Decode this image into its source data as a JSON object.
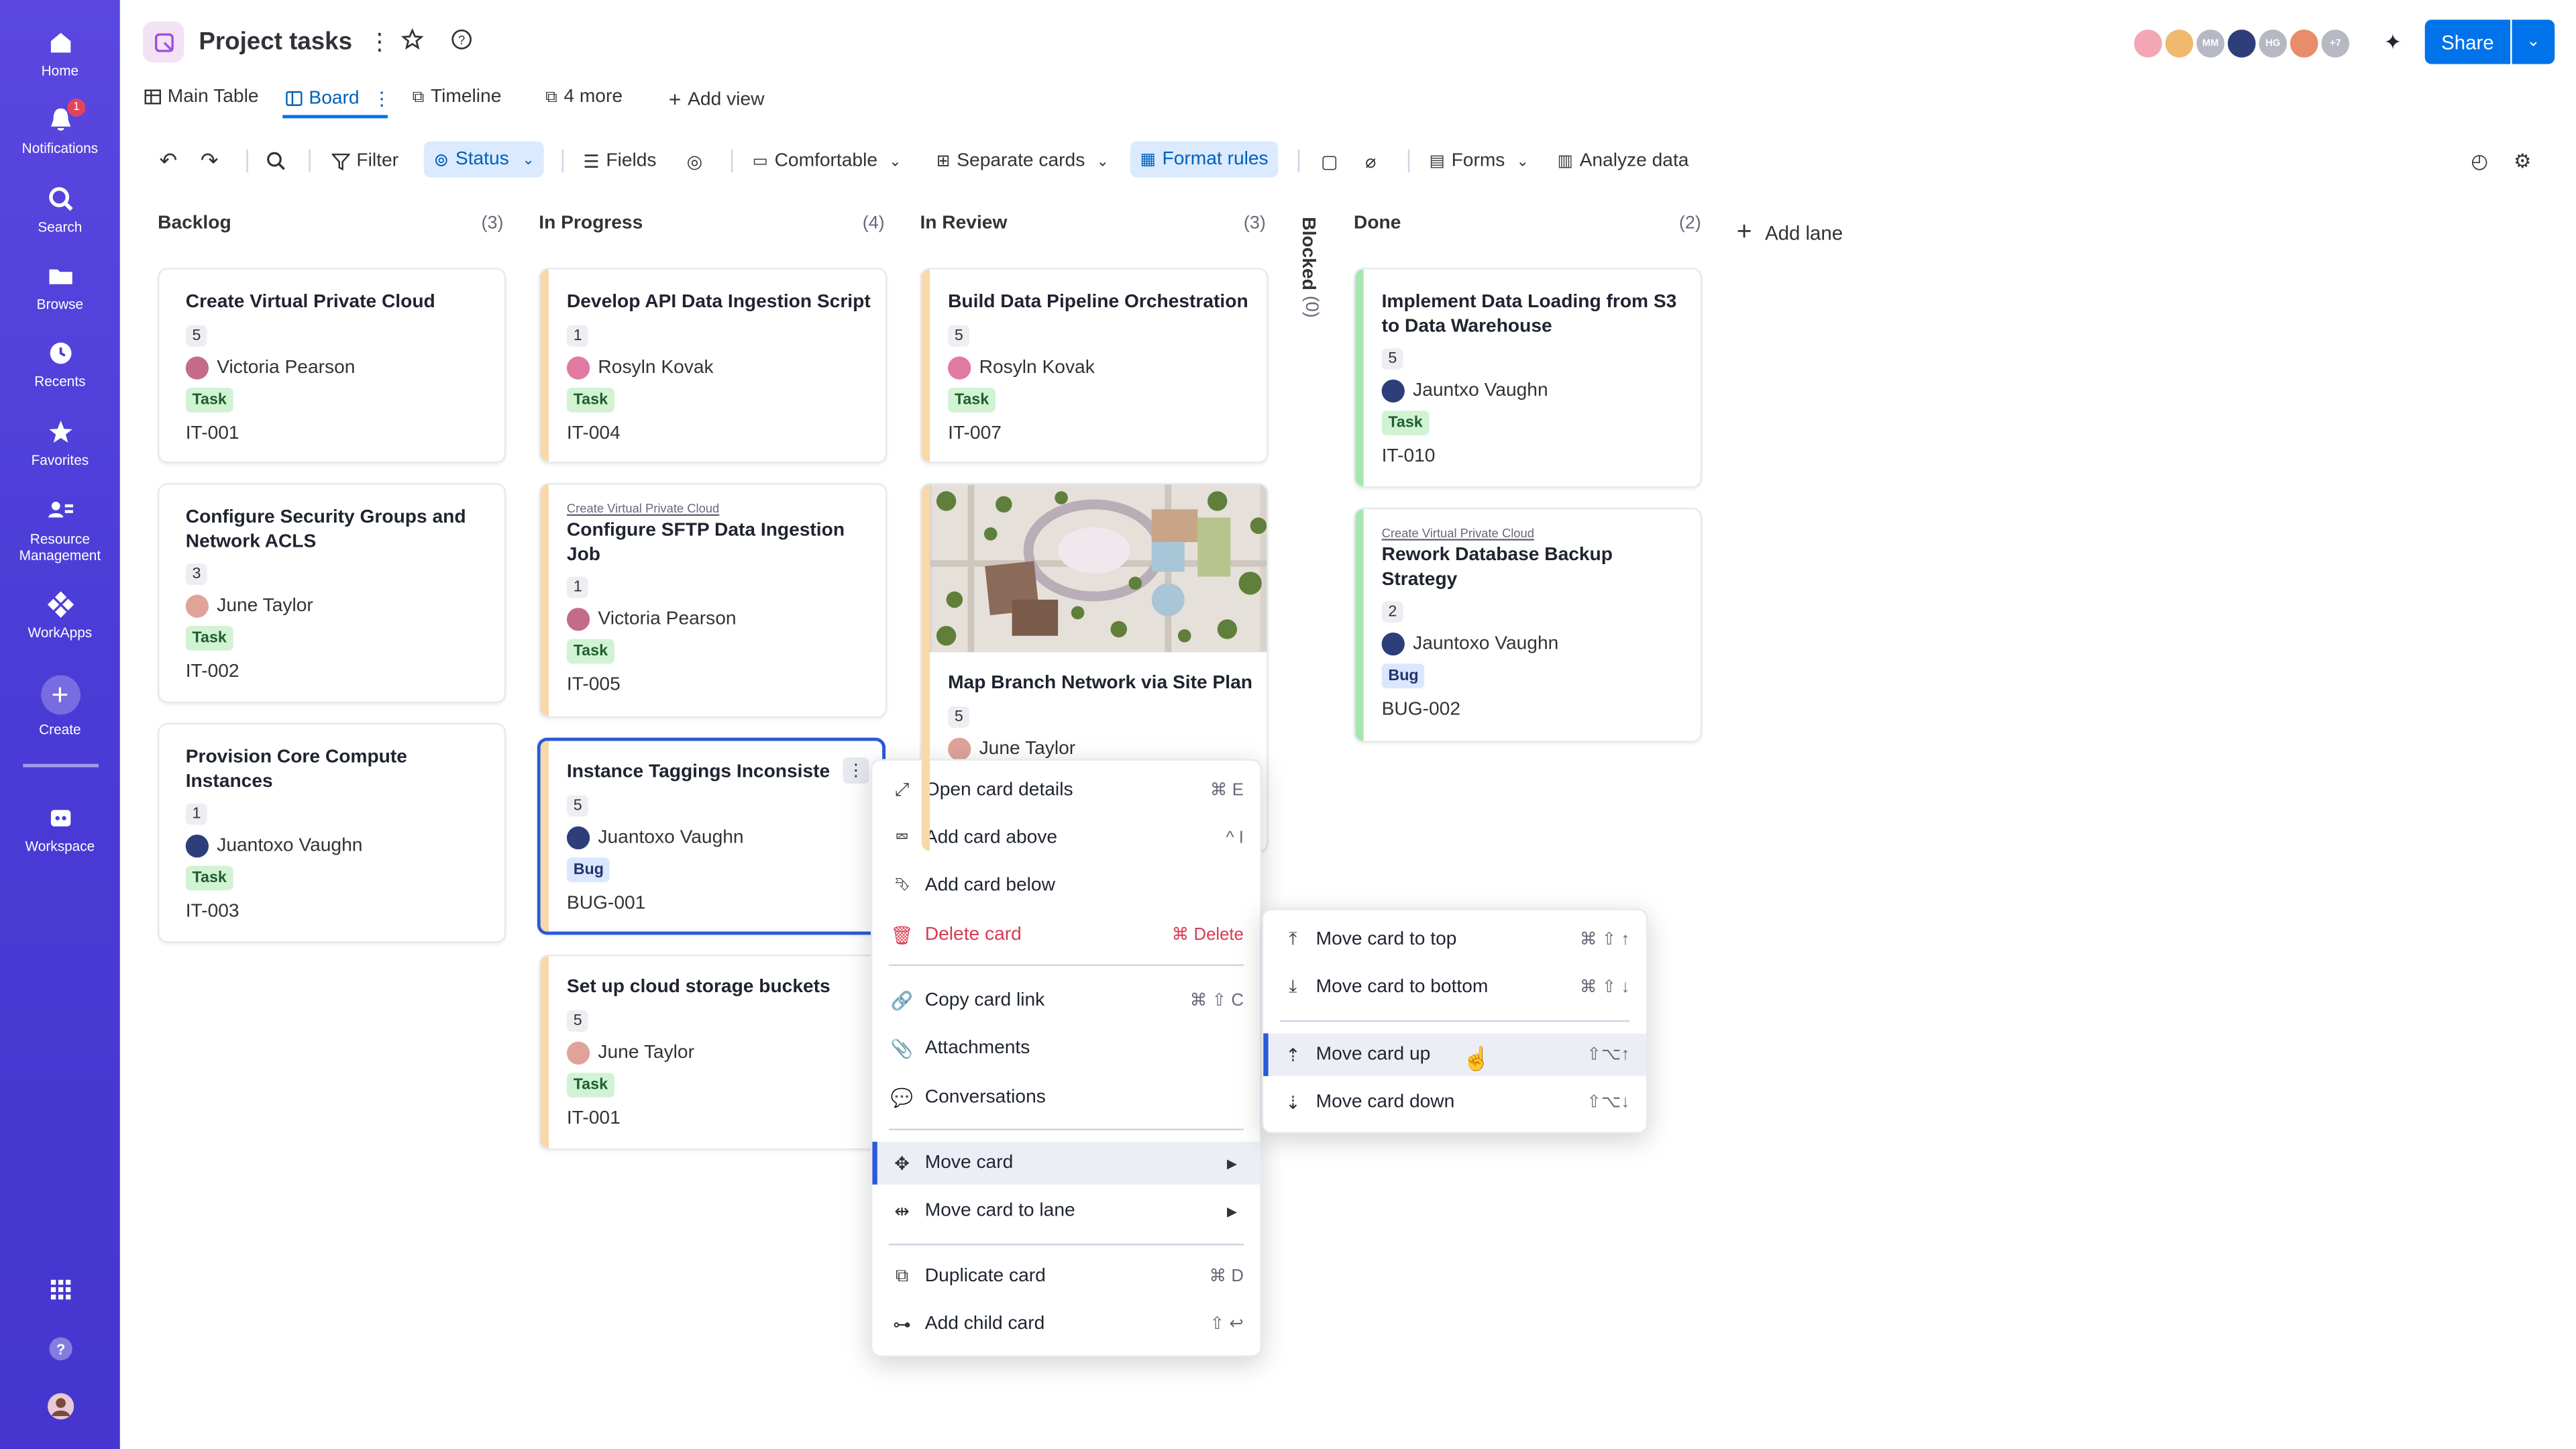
{
  "sidebar": {
    "items": [
      {
        "label": "Home",
        "icon": "home-icon"
      },
      {
        "label": "Notifications",
        "icon": "bell-icon",
        "badge": "1"
      },
      {
        "label": "Search",
        "icon": "search-icon"
      },
      {
        "label": "Browse",
        "icon": "folder-icon"
      },
      {
        "label": "Recents",
        "icon": "clock-icon"
      },
      {
        "label": "Favorites",
        "icon": "star-icon"
      },
      {
        "label": "Resource Management",
        "icon": "people-icon"
      },
      {
        "label": "WorkApps",
        "icon": "apps-icon"
      },
      {
        "label": "Create",
        "icon": "plus-icon"
      },
      {
        "label": "Workspace",
        "icon": "workspace-icon"
      }
    ]
  },
  "header": {
    "title": "Project tasks",
    "avatars_more": "+7",
    "avatar_initials": [
      "MM",
      "HG"
    ],
    "share_label": "Share"
  },
  "views": {
    "tabs": [
      "Main Table",
      "Board",
      "Timeline",
      "4 more",
      "Add view"
    ]
  },
  "toolbar": {
    "filter": "Filter",
    "status": "Status",
    "fields": "Fields",
    "density": "Comfortable",
    "cards": "Separate cards",
    "format_rules": "Format rules",
    "forms": "Forms",
    "analyze": "Analyze data"
  },
  "lanes": [
    {
      "name": "Backlog",
      "count": "(3)"
    },
    {
      "name": "In Progress",
      "count": "(4)"
    },
    {
      "name": "In Review",
      "count": "(3)"
    },
    {
      "name": "Blocked",
      "count": "(0)"
    },
    {
      "name": "Done",
      "count": "(2)"
    }
  ],
  "add_lane": "Add lane",
  "cards": {
    "backlog": [
      {
        "title": "Create Virtual Private Cloud",
        "points": "5",
        "assignee": "Victoria Pearson",
        "type": "Task",
        "id": "IT-001"
      },
      {
        "title": "Configure Security Groups and Network ACLS",
        "points": "3",
        "assignee": "June Taylor",
        "type": "Task",
        "id": "IT-002"
      },
      {
        "title": "Provision Core Compute Instances",
        "points": "1",
        "assignee": "Juantoxo Vaughn",
        "type": "Task",
        "id": "IT-003"
      }
    ],
    "in_progress": [
      {
        "title": "Develop API Data Ingestion Script",
        "points": "1",
        "assignee": "Rosyln Kovak",
        "type": "Task",
        "id": "IT-004"
      },
      {
        "parent": "Create Virtual Private Cloud",
        "title": "Configure SFTP Data Ingestion Job",
        "points": "1",
        "assignee": "Victoria Pearson",
        "type": "Task",
        "id": "IT-005"
      },
      {
        "title": "Instance Taggings Inconsiste",
        "points": "5",
        "assignee": "Juantoxo Vaughn",
        "type": "Bug",
        "id": "BUG-001"
      },
      {
        "title": "Set up cloud storage buckets",
        "points": "5",
        "assignee": "June Taylor",
        "type": "Task",
        "id": "IT-001"
      }
    ],
    "in_review": [
      {
        "title": "Build Data Pipeline Orchestration",
        "points": "5",
        "assignee": "Rosyln Kovak",
        "type": "Task",
        "id": "IT-007"
      },
      {
        "title": "Map Branch Network via Site Plan",
        "points": "5",
        "assignee": "June Taylor"
      }
    ],
    "done": [
      {
        "title": "Implement Data Loading from S3 to Data Warehouse",
        "points": "5",
        "assignee": "Jauntxo Vaughn",
        "type": "Task",
        "id": "IT-010"
      },
      {
        "parent": "Create Virtual Private Cloud",
        "title": "Rework Database Backup Strategy",
        "points": "2",
        "assignee": "Jauntoxo Vaughn",
        "type": "Bug",
        "id": "BUG-002"
      }
    ]
  },
  "context_menu": {
    "items": [
      {
        "label": "Open card details",
        "shortcut": "⌘ E",
        "icon": "expand-icon"
      },
      {
        "label": "Add card above",
        "shortcut": "^ I",
        "icon": "add-above-icon"
      },
      {
        "label": "Add card below",
        "shortcut": "",
        "icon": "add-below-icon"
      },
      {
        "label": "Delete card",
        "shortcut": "⌘ Delete",
        "icon": "trash-icon"
      },
      {
        "label": "Copy card link",
        "shortcut": "⌘ ⇧ C",
        "icon": "link-icon"
      },
      {
        "label": "Attachments",
        "shortcut": "",
        "icon": "paperclip-icon"
      },
      {
        "label": "Conversations",
        "shortcut": "",
        "icon": "chat-icon"
      },
      {
        "label": "Move card",
        "shortcut": "",
        "icon": "move-icon"
      },
      {
        "label": "Move card to lane",
        "shortcut": "",
        "icon": "move-lane-icon"
      },
      {
        "label": "Duplicate card",
        "shortcut": "⌘ D",
        "icon": "duplicate-icon"
      },
      {
        "label": "Add child card",
        "shortcut": "⇧ ↩",
        "icon": "child-card-icon"
      }
    ]
  },
  "submenu": {
    "items": [
      {
        "label": "Move card to top",
        "shortcut": "⌘ ⇧ ↑",
        "icon": "move-top-icon"
      },
      {
        "label": "Move card to bottom",
        "shortcut": "⌘ ⇧ ↓",
        "icon": "move-bottom-icon"
      },
      {
        "label": "Move card up",
        "shortcut": "⇧⌥↑",
        "icon": "move-up-icon"
      },
      {
        "label": "Move card down",
        "shortcut": "⇧⌥↓",
        "icon": "move-down-icon"
      }
    ]
  },
  "colors": {
    "sidebar": "#4a3bd6",
    "accent": "#0073ea",
    "backlog_stripe": "#f9d9a8",
    "review_stripe": "#f9d9a8",
    "done_stripe": "#a6e7b0",
    "danger": "#d83a52"
  }
}
